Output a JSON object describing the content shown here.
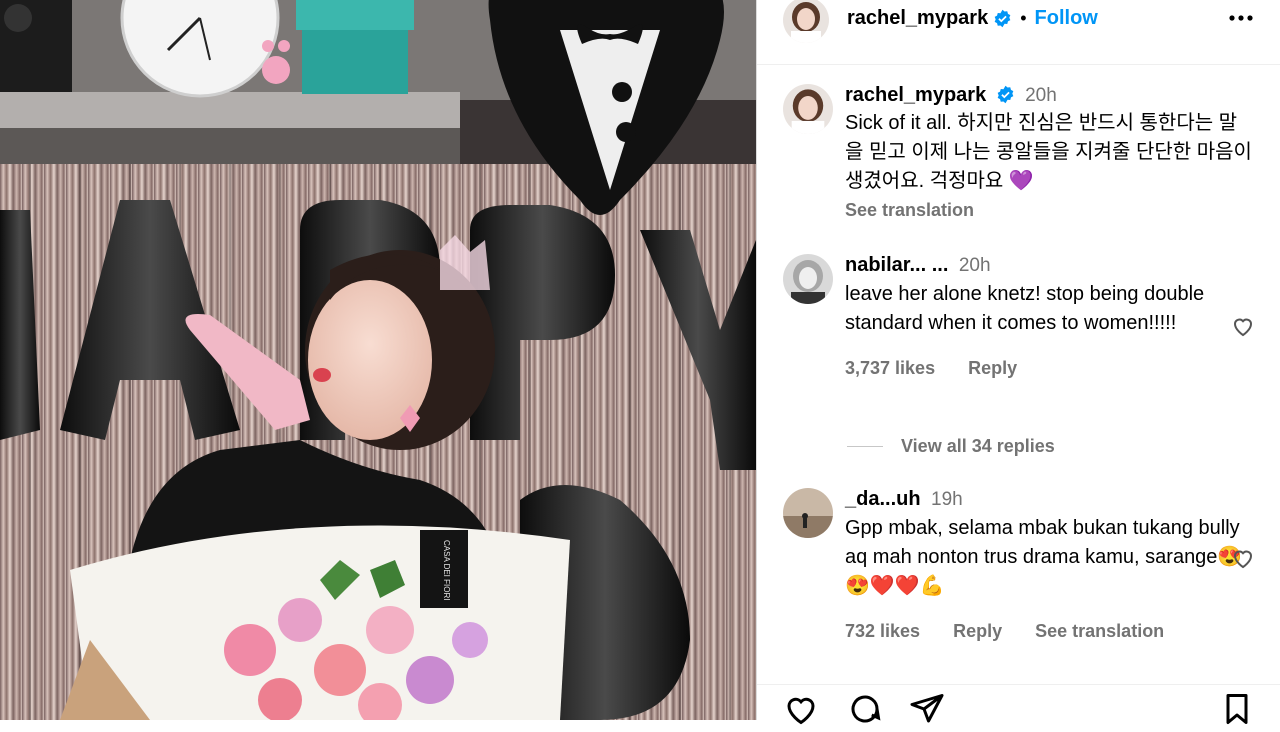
{
  "post": {
    "author": "rachel_mypark",
    "dot": "•",
    "follow_label": "Follow",
    "caption_time": "20h",
    "caption_text": "Sick of it all. 하지만 진심은 반드시 통한다는 말을 믿고 이제 나는 콩알들을 지켜줄 단단한 마음이 생겼어요. 걱정마요 💜",
    "see_translation": "See translation"
  },
  "photo": {
    "flower_tag": "CASA DEI FIORI"
  },
  "comments": [
    {
      "name": "nabilar... ...",
      "time": "20h",
      "text": "leave her alone knetz! stop being double standard when it comes to women!!!!!",
      "likes": "3,737 likes",
      "reply": "Reply",
      "view_replies": "View all 34 replies"
    },
    {
      "name": "_da...uh",
      "time": "19h",
      "text": "Gpp mbak, selama mbak bukan tukang bully aq mah nonton trus drama kamu, sarange😍😍❤️❤️💪",
      "likes": "732 likes",
      "reply": "Reply",
      "see_translation": "See translation"
    }
  ],
  "colors": {
    "accent": "#0095f6",
    "muted": "#737373",
    "verified": "#0095f6"
  },
  "icons": [
    "more-icon",
    "verified-icon",
    "heart-icon",
    "comment-icon",
    "share-icon",
    "bookmark-icon"
  ]
}
